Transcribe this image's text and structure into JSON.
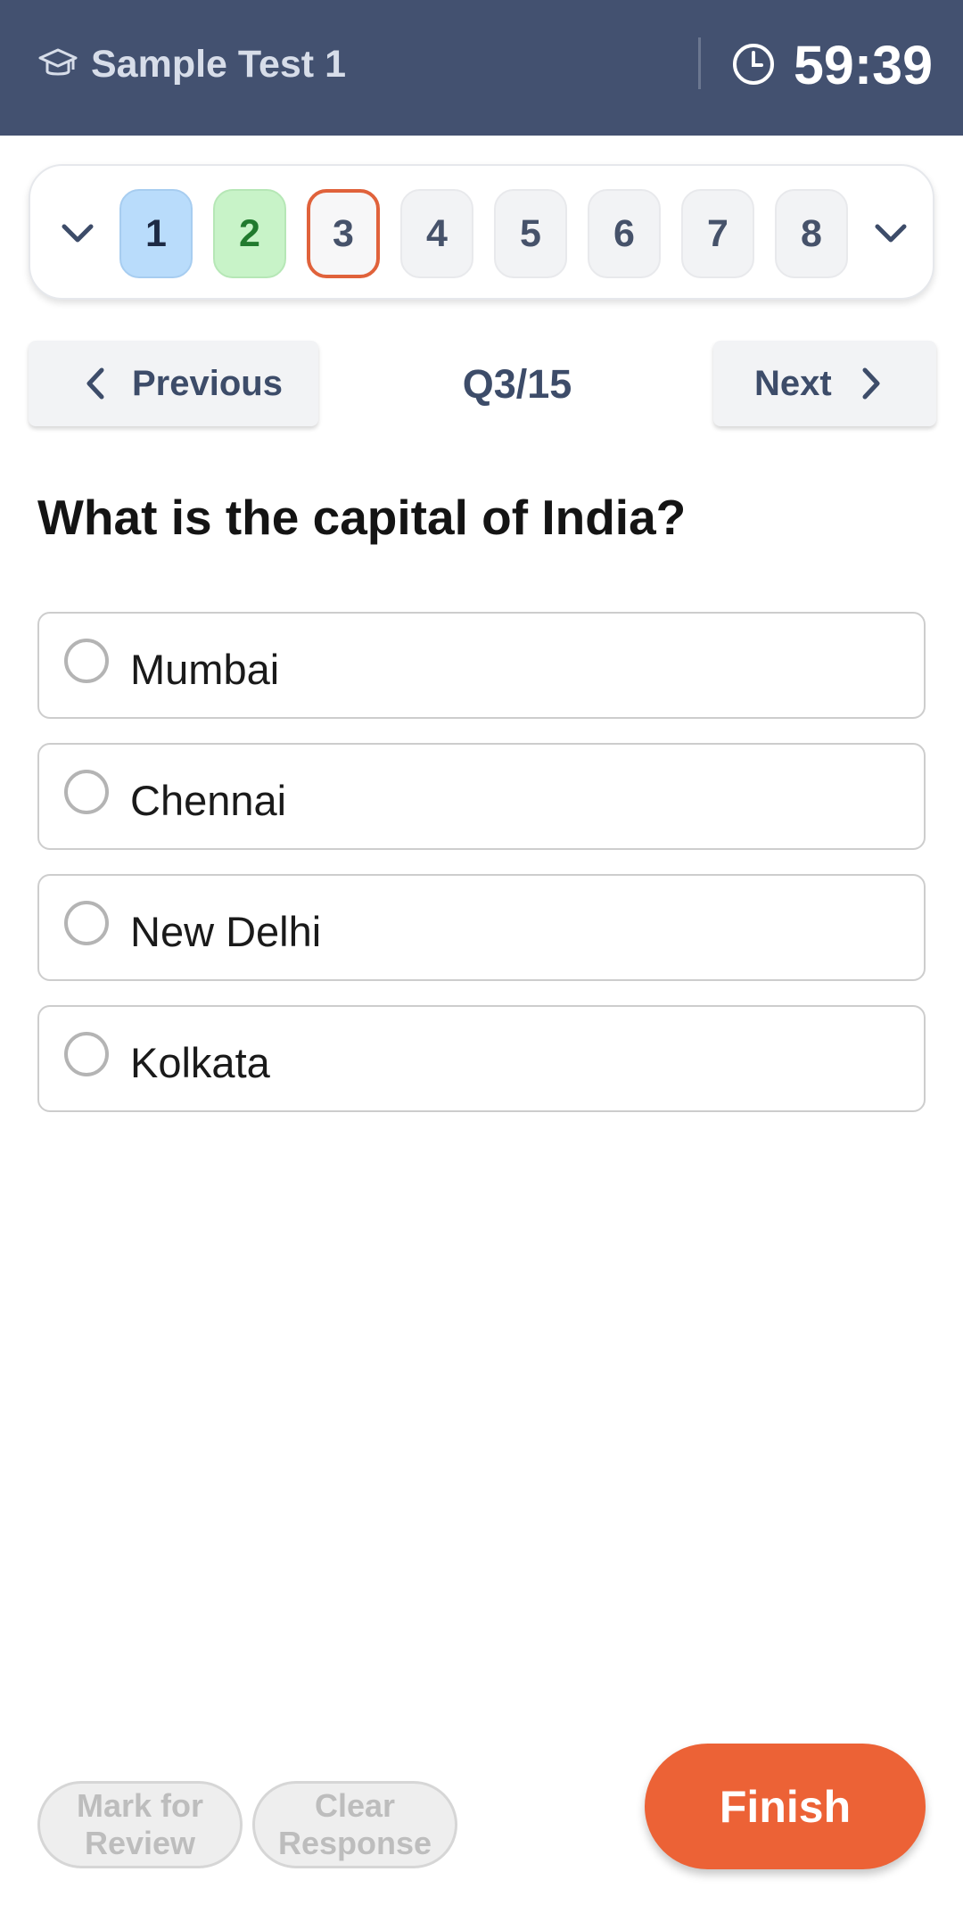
{
  "header": {
    "title": "Sample Test 1",
    "timer": "59:39",
    "icons": [
      "graduation-cap-icon",
      "clock-icon"
    ],
    "background": "#435170"
  },
  "question_nav": {
    "numbers": [
      "1",
      "2",
      "3",
      "4",
      "5",
      "6",
      "7",
      "8"
    ],
    "states": [
      "answered",
      "correct",
      "current",
      "unvisited",
      "unvisited",
      "unvisited",
      "unvisited",
      "unvisited"
    ],
    "icons": [
      "chevron-down-icon",
      "chevron-down-icon"
    ]
  },
  "navigation": {
    "previous_label": "Previous",
    "next_label": "Next",
    "counter": "Q3/15"
  },
  "question": {
    "text": "What is the capital of India?",
    "options": [
      "Mumbai",
      "Chennai",
      "New Delhi",
      "Kolkata"
    ]
  },
  "footer": {
    "mark_line1": "Mark for",
    "mark_line2": "Review",
    "clear_line1": "Clear",
    "clear_line2": "Response",
    "finish_label": "Finish",
    "accent_color": "#ec6236"
  }
}
